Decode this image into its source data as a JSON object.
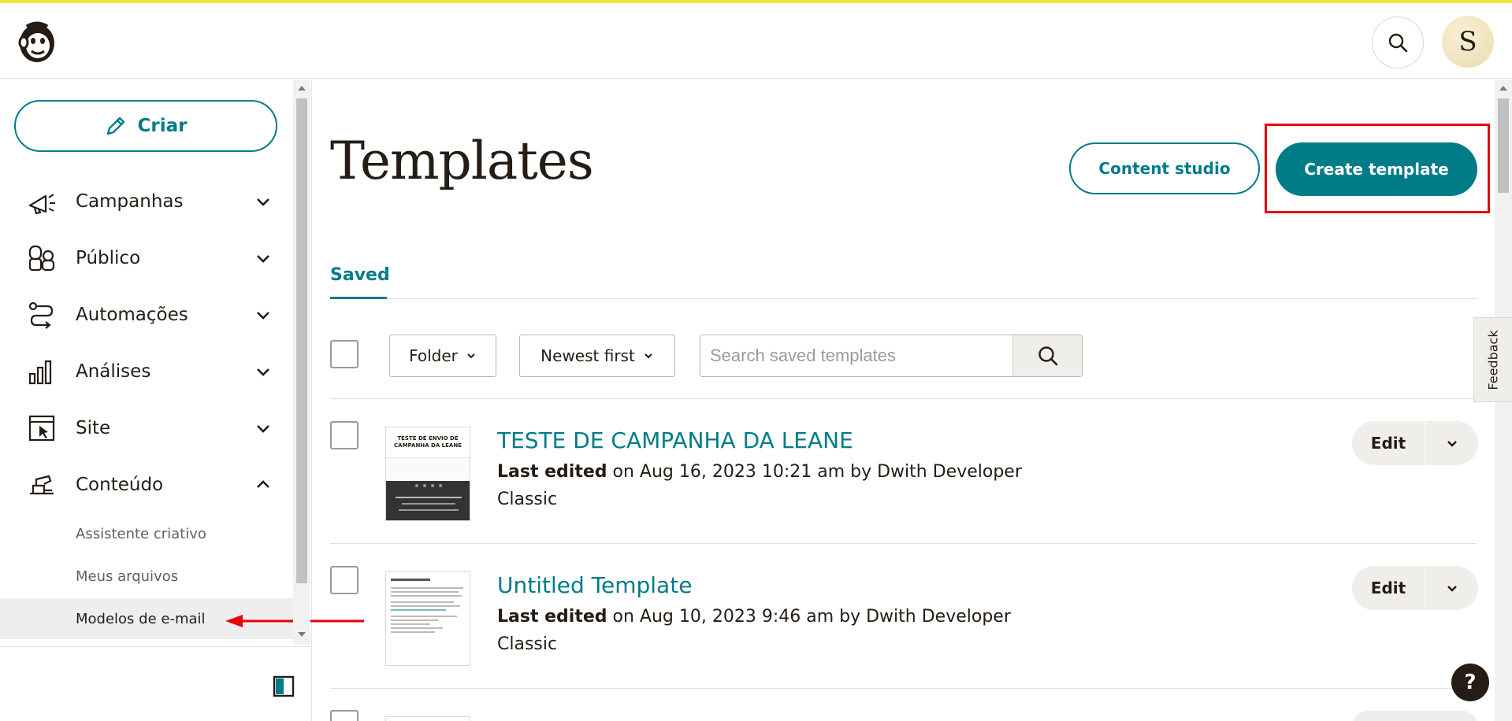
{
  "topbar": {
    "logo_icon": "mailchimp-freddie-icon",
    "search_icon": "search-icon",
    "avatar_initial": "S"
  },
  "sidebar": {
    "create_label": "Criar",
    "nav": [
      {
        "label": "Campanhas",
        "icon": "megaphone-icon",
        "expanded": false
      },
      {
        "label": "Público",
        "icon": "audience-icon",
        "expanded": false
      },
      {
        "label": "Automações",
        "icon": "automation-icon",
        "expanded": false
      },
      {
        "label": "Análises",
        "icon": "bar-chart-icon",
        "expanded": false
      },
      {
        "label": "Site",
        "icon": "website-icon",
        "expanded": false
      },
      {
        "label": "Conteúdo",
        "icon": "content-icon",
        "expanded": true
      }
    ],
    "content_sub": [
      {
        "label": "Assistente criativo"
      },
      {
        "label": "Meus arquivos"
      },
      {
        "label": "Modelos de e-mail",
        "active": true
      }
    ]
  },
  "main": {
    "title": "Templates",
    "content_studio_label": "Content studio",
    "create_template_label": "Create template",
    "tab_saved": "Saved",
    "folder_label": "Folder",
    "sort_label": "Newest first",
    "search_placeholder": "Search saved templates",
    "templates": [
      {
        "name": "TESTE DE CAMPANHA DA LEANE",
        "last_edited_label": "Last edited",
        "meta": "on Aug 16, 2023 10:21 am by Dwith Developer",
        "type": "Classic",
        "thumb_heading": "TESTE DE ENVIO DE CAMPANHA DA LEANE",
        "edit_label": "Edit"
      },
      {
        "name": "Untitled Template",
        "last_edited_label": "Last edited",
        "meta": "on Aug 10, 2023 9:46 am by Dwith Developer",
        "type": "Classic",
        "edit_label": "Edit"
      }
    ]
  },
  "feedback_label": "Feedback",
  "help_label": "?",
  "colors": {
    "accent": "#007c89",
    "highlight": "#e8000b",
    "top_strip": "#f0e442",
    "text": "#241c15"
  }
}
